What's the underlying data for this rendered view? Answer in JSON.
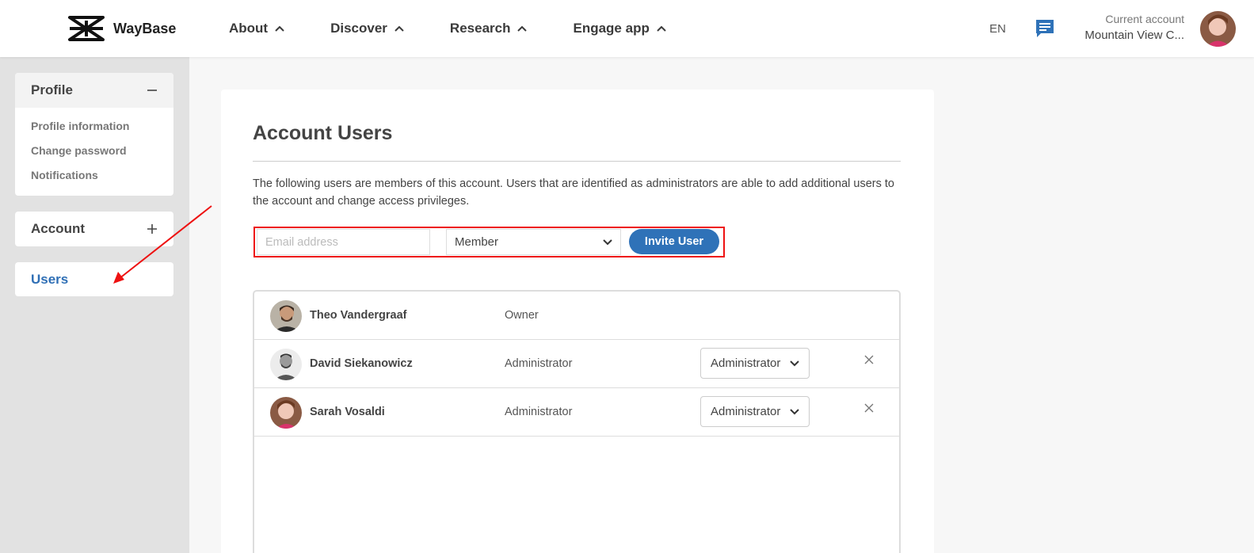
{
  "header": {
    "brand": "WayBase",
    "nav": [
      {
        "label": "About"
      },
      {
        "label": "Discover"
      },
      {
        "label": "Research"
      },
      {
        "label": "Engage app"
      }
    ],
    "language": "EN",
    "account_label": "Current account",
    "account_name": "Mountain View C..."
  },
  "sidebar": {
    "profile": {
      "title": "Profile",
      "items": [
        "Profile information",
        "Change password",
        "Notifications"
      ]
    },
    "account": {
      "title": "Account"
    },
    "users": {
      "title": "Users"
    }
  },
  "main": {
    "title": "Account Users",
    "description": "The following users are members of this account. Users that are identified as administrators are able to add additional users to the account and change access privileges.",
    "invite": {
      "email_placeholder": "Email address",
      "role_selected": "Member",
      "button": "Invite User"
    },
    "users": [
      {
        "name": "Theo Vandergraaf",
        "role": "Owner"
      },
      {
        "name": "David Siekanowicz",
        "role": "Administrator",
        "role_select": "Administrator"
      },
      {
        "name": "Sarah Vosaldi",
        "role": "Administrator",
        "role_select": "Administrator"
      }
    ]
  },
  "colors": {
    "accent": "#2f72b8",
    "highlight": "#e11111",
    "sidebar_bg": "#e2e2e2"
  }
}
